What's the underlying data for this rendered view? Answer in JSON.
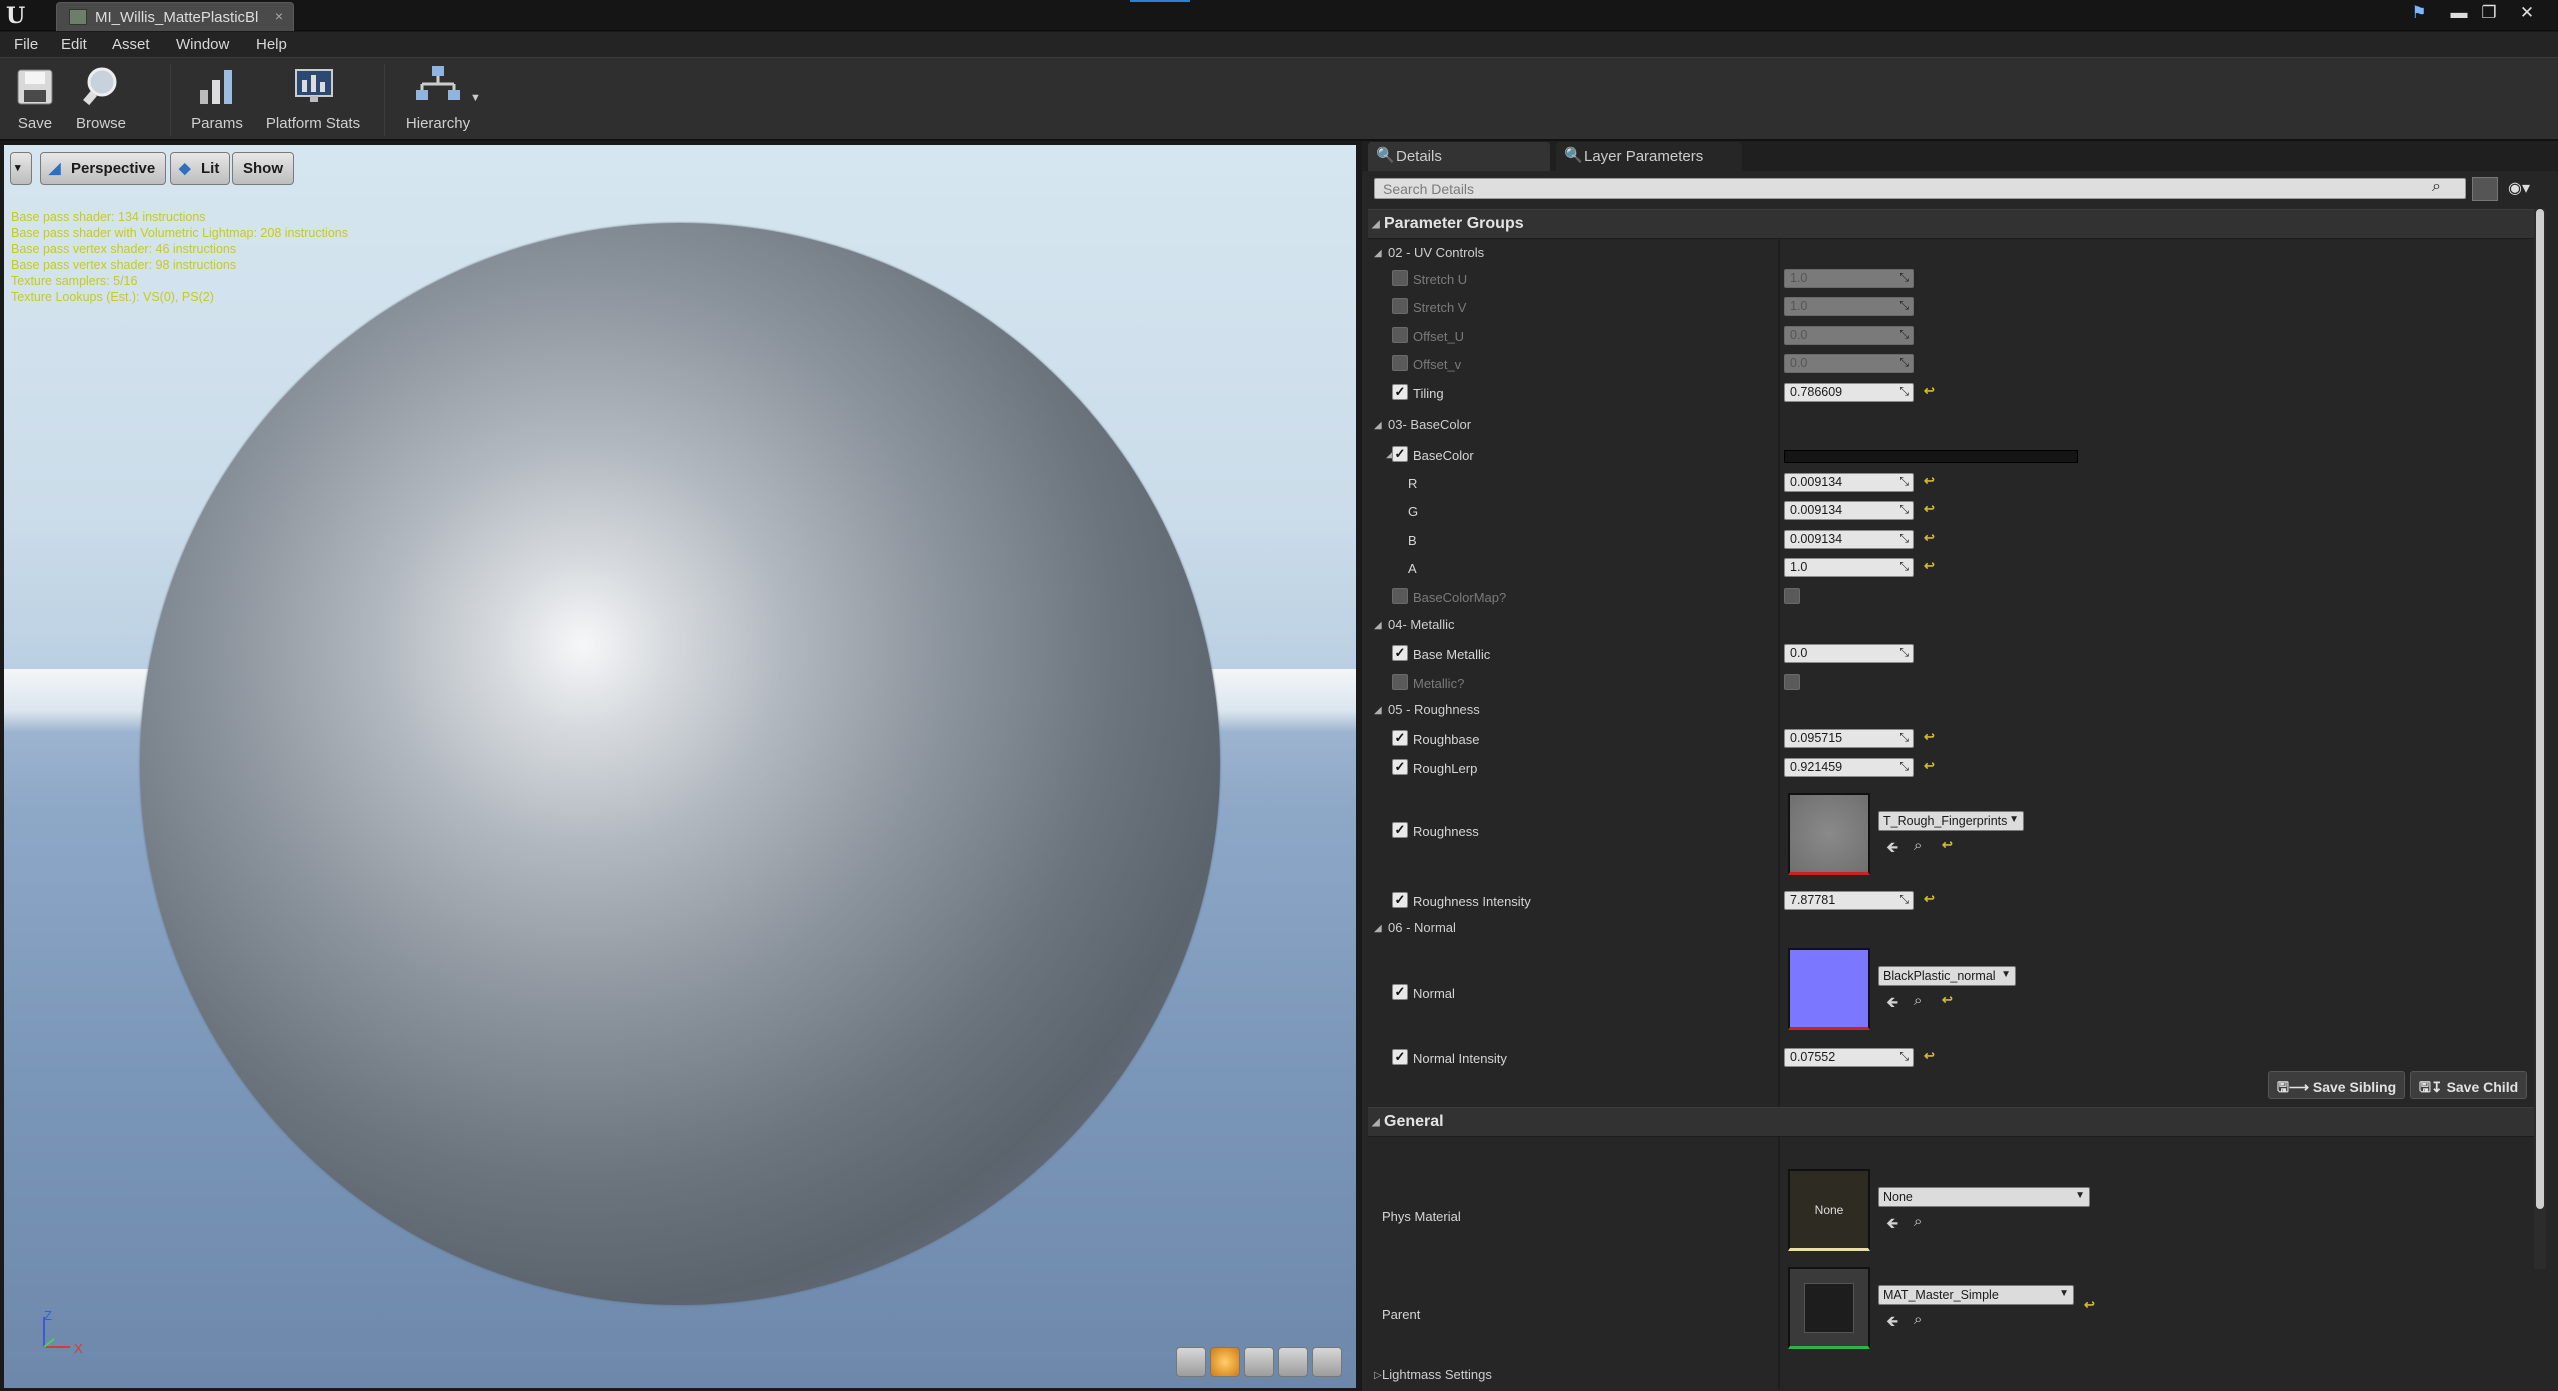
{
  "window": {
    "tab_title": "MI_Willis_MattePlasticBl",
    "tab_close": "×",
    "min": "▬",
    "max": "❐",
    "close": "✕",
    "logo": "U"
  },
  "menu": [
    "File",
    "Edit",
    "Asset",
    "Window",
    "Help"
  ],
  "toolbar": {
    "save": "Save",
    "browse": "Browse",
    "params": "Params",
    "platform_stats": "Platform Stats",
    "hierarchy": "Hierarchy"
  },
  "viewport": {
    "dropdown": "▾",
    "perspective": "Perspective",
    "lit": "Lit",
    "show": "Show",
    "stats": [
      "Base pass shader: 134 instructions",
      "Base pass shader with Volumetric Lightmap: 208 instructions",
      "Base pass vertex shader: 46 instructions",
      "Base pass vertex shader: 98 instructions",
      "Texture samplers: 5/16",
      "Texture Lookups (Est.): VS(0), PS(2)"
    ],
    "axis_z": "Z",
    "axis_x": "X"
  },
  "panel": {
    "tabs": [
      "Details",
      "Layer Parameters"
    ],
    "search_placeholder": "Search Details",
    "section_params": "Parameter Groups",
    "section_general": "General",
    "groups": {
      "uv": "02 - UV Controls",
      "basecolor": "03- BaseColor",
      "metallic": "04- Metallic",
      "roughness": "05 - Roughness",
      "normal": "06 - Normal"
    },
    "uv": [
      {
        "name": "Stretch U",
        "value": "1.0",
        "enabled": false
      },
      {
        "name": "Stretch V",
        "value": "1.0",
        "enabled": false
      },
      {
        "name": "Offset_U",
        "value": "0.0",
        "enabled": false
      },
      {
        "name": "Offset_v",
        "value": "0.0",
        "enabled": false
      },
      {
        "name": "Tiling",
        "value": "0.786609",
        "enabled": true
      }
    ],
    "basecolor": {
      "label": "BaseColor",
      "swatch": "#151515",
      "r_label": "R",
      "r": "0.009134",
      "g_label": "G",
      "g": "0.009134",
      "b_label": "B",
      "b": "0.009134",
      "a_label": "A",
      "a": "1.0",
      "map_label": "BaseColorMap?"
    },
    "metallic": {
      "base_label": "Base Metallic",
      "base": "0.0",
      "switch_label": "Metallic?"
    },
    "roughness": {
      "base_label": "Roughbase",
      "base": "0.095715",
      "lerp_label": "RoughLerp",
      "lerp": "0.921459",
      "tex_label": "Roughness",
      "tex_value": "T_Rough_Fingerprints",
      "intensity_label": "Roughness Intensity",
      "intensity": "7.87781"
    },
    "normal": {
      "tex_label": "Normal",
      "tex_value": "BlackPlastic_normal",
      "intensity_label": "Normal Intensity",
      "intensity": "0.07552"
    },
    "save_sibling": "Save Sibling",
    "save_child": "Save Child",
    "general": {
      "phys_label": "Phys Material",
      "phys_value": "None",
      "phys_thumb": "None",
      "parent_label": "Parent",
      "parent_value": "MAT_Master_Simple",
      "lightmass": "Lightmass Settings"
    },
    "colors": {
      "accent_reset": "#d4b832",
      "normal_swatch": "#7b77ff"
    }
  }
}
